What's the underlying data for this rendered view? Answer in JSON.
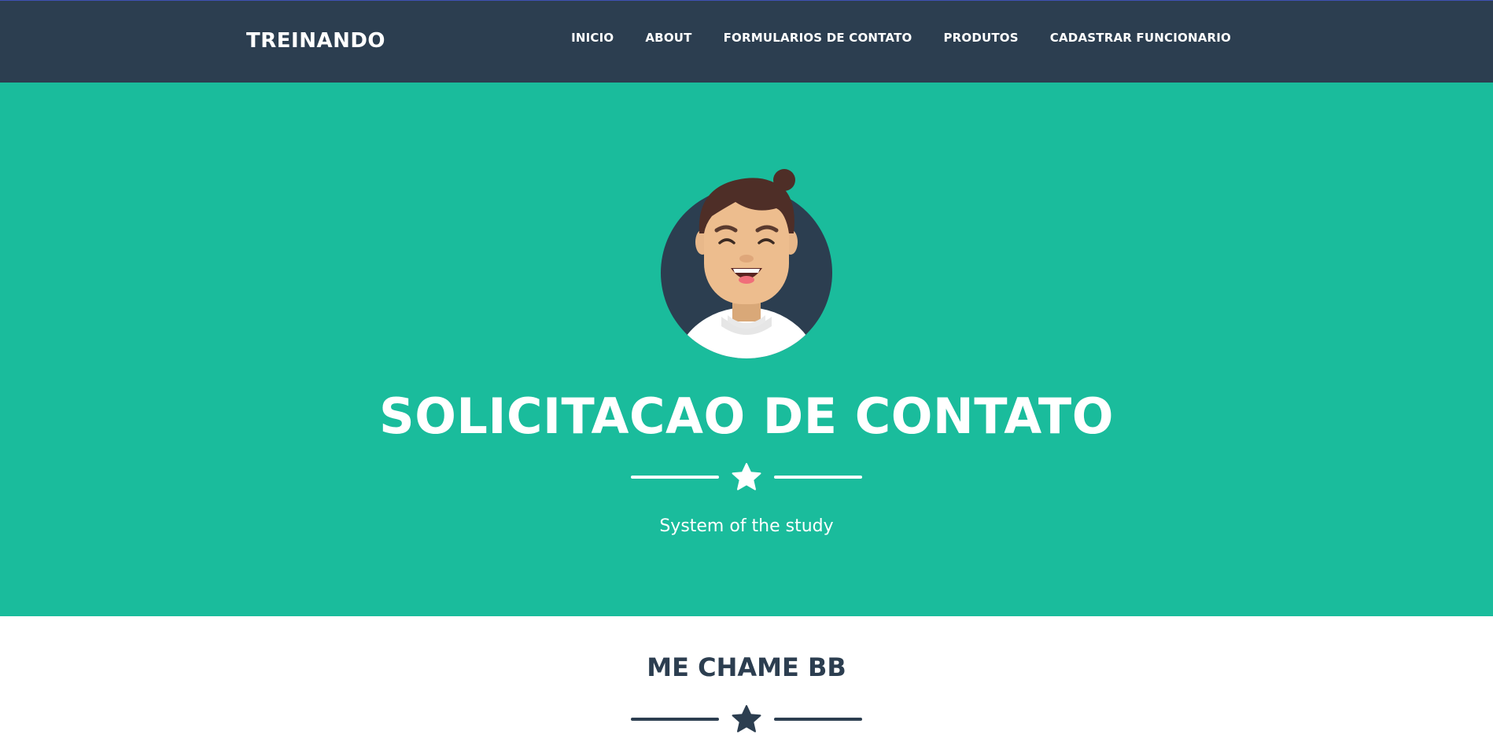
{
  "navbar": {
    "brand": "TREINANDO",
    "items": [
      {
        "label": "INICIO"
      },
      {
        "label": "ABOUT"
      },
      {
        "label": "FORMULARIOS DE CONTATO"
      },
      {
        "label": "PRODUTOS"
      },
      {
        "label": "CADASTRAR FUNCIONARIO"
      }
    ]
  },
  "masthead": {
    "avatar_icon": "smiling-person-avatar",
    "title": "SOLICITACAO DE CONTATO",
    "divider_icon": "star-icon",
    "subtitle": "System of the study"
  },
  "section": {
    "title": "ME CHAME BB",
    "divider_icon": "star-icon"
  },
  "colors": {
    "navbar_bg": "#2c3e50",
    "masthead_bg": "#1abc9c",
    "white": "#ffffff",
    "dark": "#2c3e50"
  }
}
